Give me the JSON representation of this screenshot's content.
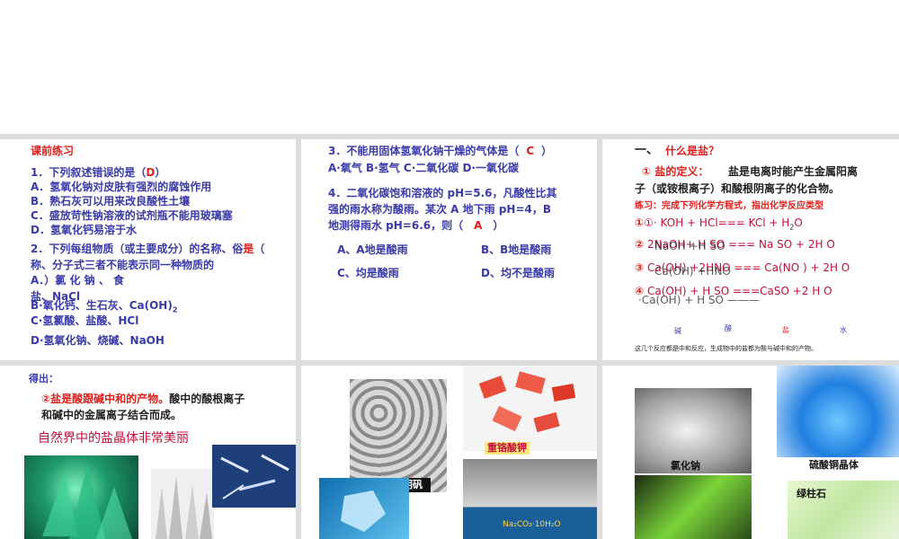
{
  "slide1": {
    "heading": "课前练习",
    "q1_pre": "1．下列叙述错误的是（",
    "q1_answer": "D",
    "q1_post": "）",
    "q1_a": "A．氢氧化钠对皮肤有强烈的腐蚀作用",
    "q1_b": "B．熟石灰可以用来改良酸性土壤",
    "q1_c": "C．盛放苛性钠溶液的试剂瓶不能用玻璃塞",
    "q1_d": "D．氢氧化钙易溶于水",
    "q2_line1": "2．下列每组物质（或主要成分）的名称、俗",
    "q2_line1_mark": "是",
    "q2_line1_end": "（",
    "q2_line2": "称、分子式三者不能表示同一种物质的",
    "q2_a1": "A．）氯  化  钠  、  食",
    "q2_a2": "盐、NaCl",
    "q2_b": "B·氧化钙、生石灰、Ca(OH)",
    "q2_b_sub": "2",
    "q2_c": "C·氢氯酸、盐酸、HCl",
    "q2_d": "D·氢氧化钠、烧碱、NaOH"
  },
  "slide2": {
    "q3": "3．不能用固体氢氧化钠干燥的气体是（",
    "q3_answer": "C",
    "q3_end": "）",
    "q3_options": "A·氧气   B·氢气   C·二氧化碳    D·一氧化碳",
    "q4_line1": "4．二氧化碳饱和溶液的 pH=5.6，凡酸性比其",
    "q4_line2": "强的雨水称为酸雨。某次 A 地下雨 pH=4，B",
    "q4_line3_pre": "地测得雨水 pH=6.6，则（",
    "q4_answer": "A",
    "q4_line3_end": "）",
    "q4_a": "A、A地是酸雨",
    "q4_b": "B、B地是酸雨",
    "q4_c": "C、均是酸雨",
    "q4_d": "D、均不是酸雨"
  },
  "slide3": {
    "heading_num": "一、",
    "heading": "什么是盐？",
    "def_label": "① 盐的定义：",
    "def_text1": "盐是电离时能产生金属阳离",
    "def_text2": "子（或铵根离子）和酸根阴离子的化合物。",
    "practice": "练习：完成下列化学方程式，指出化学反应类型",
    "eq1": "①· KOH  +  HCl=== KCl  + H",
    "eq1_tail": "O",
    "eq2_red": "②",
    "eq2": "2NaOH+ H  SO   === Na SO   + 2H O",
    "eq2_overlay": "NaOH +H SO",
    "eq3_red": "③",
    "eq3": "Ca(OH)  +2HNO  === Ca(NO )  + 2H O",
    "eq3_overlay": "Ca(OH)  +HNO",
    "eq4_red": "④",
    "eq4": "Ca(OH)  + H SO  ===CaSO   +2 H O",
    "eq4_overlay": "·Ca(OH)  + H SO ———",
    "legend": [
      "碱",
      "酸",
      "盐",
      "水"
    ],
    "note": "这几个反应都是中和反应，生成物中的盐都为酸与碱中和的产物。"
  },
  "slide4": {
    "label": "得出：",
    "def2_num": "②",
    "def2_bold": "盐是酸跟碱中和的产物。",
    "def2_rest": "酸中的酸根离子",
    "def2_line2": "和碱中的金属离子结合而成。",
    "crystals_title": "自然界中的盐晶体非常美丽"
  },
  "slide5": {
    "alum": "明矾",
    "dichromate": "重铬酸钾",
    "soda": "Na₂CO₃·10H₂O"
  },
  "slide6": {
    "nacl": "氯化钠",
    "cuso4": "硫酸铜晶体",
    "beryl": "绿柱石"
  },
  "colors": {
    "accent_blue": "#3a3aa8",
    "accent_red": "#e0201c",
    "divider": "#dcdcdc"
  }
}
